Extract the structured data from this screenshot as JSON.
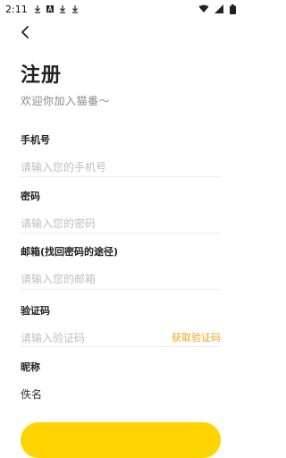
{
  "status": {
    "time": "2:11",
    "icons": [
      "download-icon",
      "download-icon",
      "a-icon",
      "download-icon",
      "download-icon"
    ],
    "right_icons": [
      "wifi-icon",
      "signal-icon",
      "battery-icon"
    ]
  },
  "header": {
    "back_icon": "chevron-left-icon",
    "title": "注册",
    "subtitle": "欢迎你加入猫番～"
  },
  "form": {
    "phone": {
      "label": "手机号",
      "placeholder": "请输入您的手机号"
    },
    "password": {
      "label": "密码",
      "placeholder": "请输入您的密码"
    },
    "email": {
      "label": "邮箱(找回密码的途径)",
      "placeholder": "请输入您的邮箱"
    },
    "code": {
      "label": "验证码",
      "placeholder": "请输入验证码",
      "action": "获取验证码"
    },
    "nickname": {
      "label": "昵称",
      "value": "佚名"
    }
  },
  "colors": {
    "accent": "#f1a420",
    "cta": "#ffd400"
  }
}
